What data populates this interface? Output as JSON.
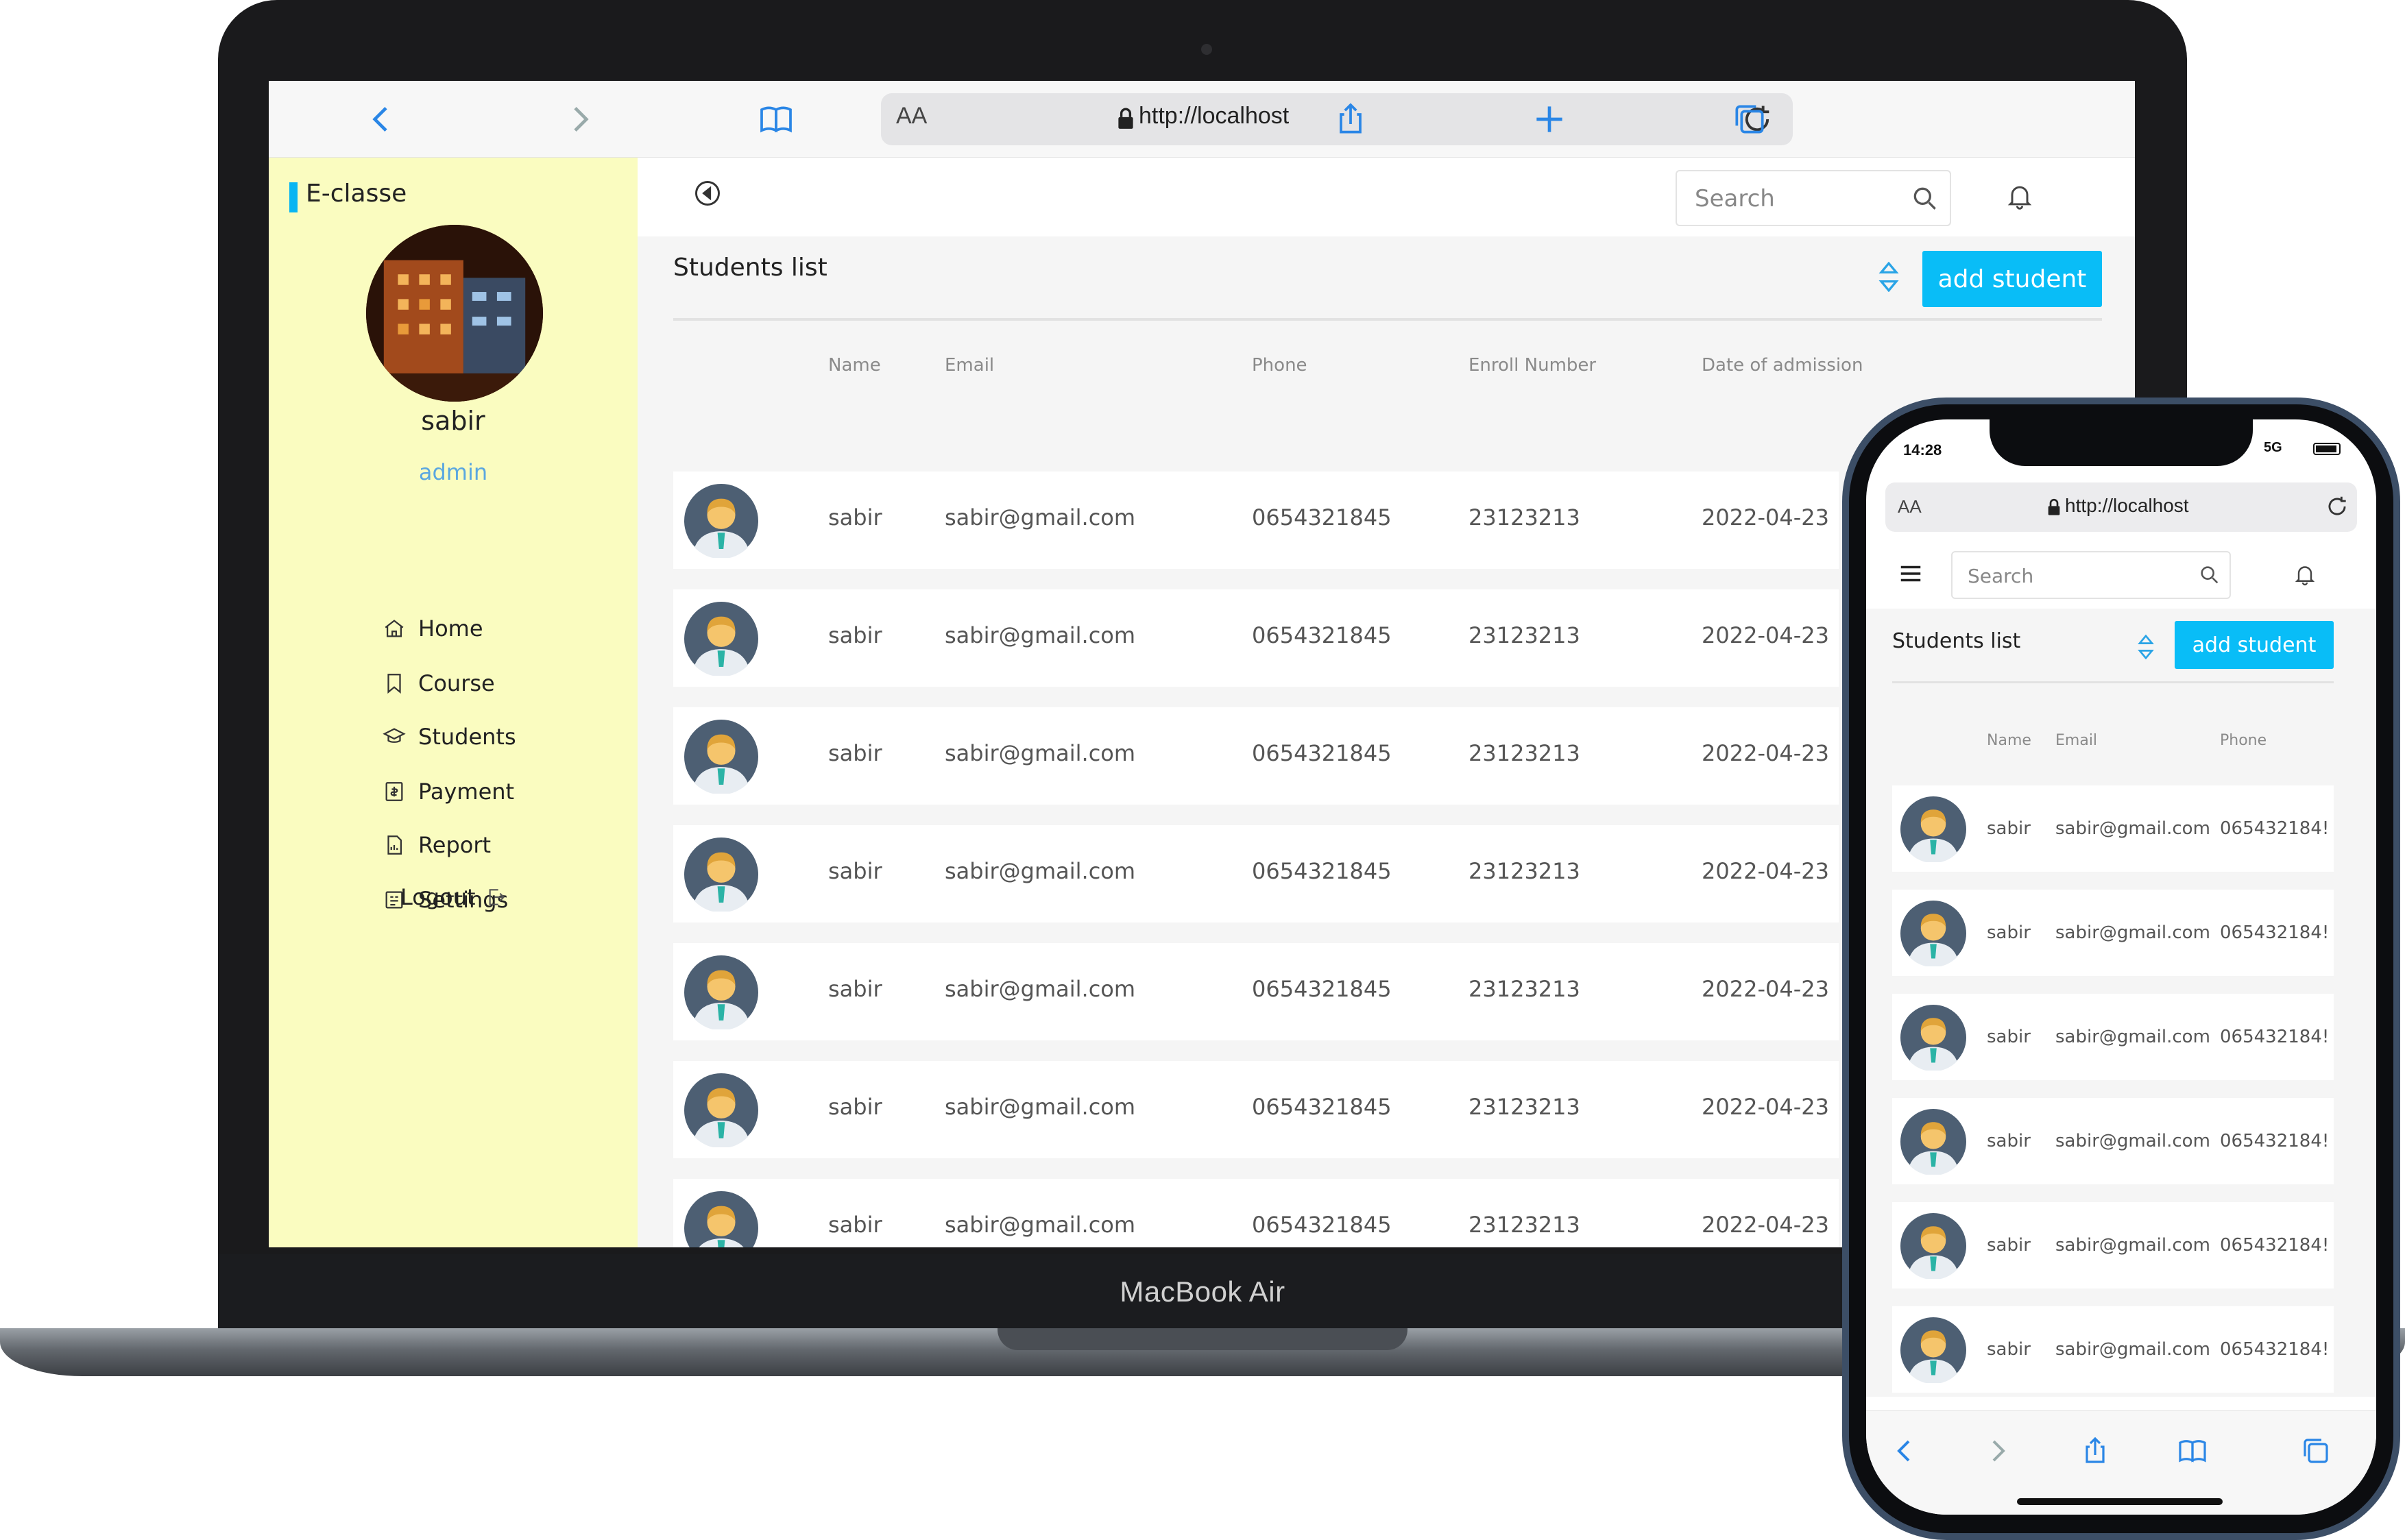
{
  "laptop": {
    "brand_label": "MacBook Air",
    "browser": {
      "aa_label": "AA",
      "url": "http://localhost"
    },
    "app": {
      "brand": "E-classe",
      "user": {
        "name": "sabir",
        "role": "admin"
      },
      "nav": [
        {
          "label": "Home",
          "icon": "home-icon"
        },
        {
          "label": "Course",
          "icon": "bookmark-icon"
        },
        {
          "label": "Students",
          "icon": "graduation-cap-icon"
        },
        {
          "label": "Payment",
          "icon": "payment-icon"
        },
        {
          "label": "Report",
          "icon": "report-icon"
        },
        {
          "label": "Settings",
          "icon": "settings-icon"
        }
      ],
      "logout_label": "Logout",
      "search_placeholder": "Search",
      "list_title": "Students list",
      "add_button": "add student",
      "columns": [
        "Name",
        "Email",
        "Phone",
        "Enroll Number",
        "Date of admission"
      ],
      "rows": [
        {
          "name": "sabir",
          "email": "sabir@gmail.com",
          "phone": "0654321845",
          "enroll": "23123213",
          "date": "2022-04-23"
        },
        {
          "name": "sabir",
          "email": "sabir@gmail.com",
          "phone": "0654321845",
          "enroll": "23123213",
          "date": "2022-04-23"
        },
        {
          "name": "sabir",
          "email": "sabir@gmail.com",
          "phone": "0654321845",
          "enroll": "23123213",
          "date": "2022-04-23"
        },
        {
          "name": "sabir",
          "email": "sabir@gmail.com",
          "phone": "0654321845",
          "enroll": "23123213",
          "date": "2022-04-23"
        },
        {
          "name": "sabir",
          "email": "sabir@gmail.com",
          "phone": "0654321845",
          "enroll": "23123213",
          "date": "2022-04-23"
        },
        {
          "name": "sabir",
          "email": "sabir@gmail.com",
          "phone": "0654321845",
          "enroll": "23123213",
          "date": "2022-04-23"
        },
        {
          "name": "sabir",
          "email": "sabir@gmail.com",
          "phone": "0654321845",
          "enroll": "23123213",
          "date": "2022-04-23"
        }
      ]
    }
  },
  "phone": {
    "time": "14:28",
    "network": "5G",
    "browser": {
      "aa_label": "AA",
      "url": "http://localhost"
    },
    "app": {
      "search_placeholder": "Search",
      "list_title": "Students list",
      "add_button": "add student",
      "columns": [
        "Name",
        "Email",
        "Phone"
      ],
      "rows": [
        {
          "name": "sabir",
          "email": "sabir@gmail.com",
          "phone": "065432184!"
        },
        {
          "name": "sabir",
          "email": "sabir@gmail.com",
          "phone": "065432184!"
        },
        {
          "name": "sabir",
          "email": "sabir@gmail.com",
          "phone": "065432184!"
        },
        {
          "name": "sabir",
          "email": "sabir@gmail.com",
          "phone": "065432184!"
        },
        {
          "name": "sabir",
          "email": "sabir@gmail.com",
          "phone": "065432184!"
        },
        {
          "name": "sabir",
          "email": "sabir@gmail.com",
          "phone": "065432184!"
        }
      ]
    }
  },
  "colors": {
    "accent": "#09bdf7",
    "sidebar_bg": "#fafcc0",
    "browser_blue": "#2a86e6",
    "role_blue": "#5aa7e0"
  }
}
